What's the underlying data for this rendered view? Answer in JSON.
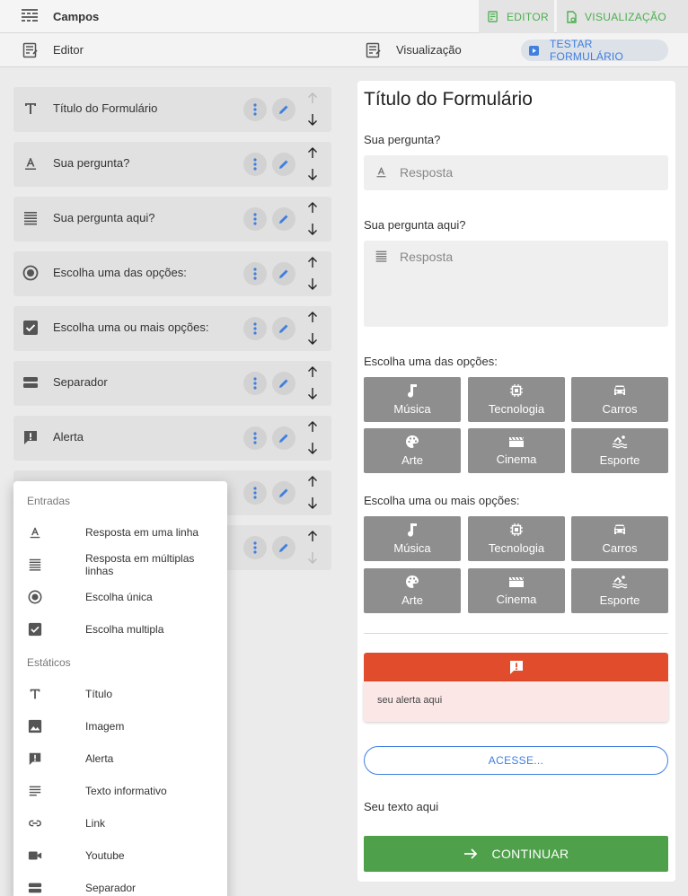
{
  "topbar": {
    "title": "Campos",
    "tab_editor": "EDITOR",
    "tab_view": "VISUALIZAÇÃO"
  },
  "subbar": {
    "editor_label": "Editor",
    "view_label": "Visualização",
    "test_label": "TESTAR FORMULÁRIO"
  },
  "fields": [
    {
      "label": "Título do Formulário",
      "icon": "title-icon"
    },
    {
      "label": "Sua pergunta?",
      "icon": "short-text-icon"
    },
    {
      "label": "Sua pergunta aqui?",
      "icon": "long-text-icon"
    },
    {
      "label": "Escolha uma das opções:",
      "icon": "radio-icon"
    },
    {
      "label": "Escolha uma ou mais opções:",
      "icon": "checkbox-icon"
    },
    {
      "label": "Separador",
      "icon": "separator-icon"
    },
    {
      "label": "Alerta",
      "icon": "alert-icon"
    }
  ],
  "menu": {
    "group_inputs": "Entradas",
    "group_static": "Estáticos",
    "items": [
      {
        "label": "Resposta em uma linha",
        "icon": "short-text-icon"
      },
      {
        "label": "Resposta em múltiplas linhas",
        "icon": "long-text-icon"
      },
      {
        "label": "Escolha única",
        "icon": "radio-icon"
      },
      {
        "label": "Escolha multipla",
        "icon": "checkbox-icon"
      },
      {
        "label": "Título",
        "icon": "title-icon"
      },
      {
        "label": "Imagem",
        "icon": "image-icon"
      },
      {
        "label": "Alerta",
        "icon": "alert-icon"
      },
      {
        "label": "Texto informativo",
        "icon": "text-info-icon"
      },
      {
        "label": "Link",
        "icon": "link-icon"
      },
      {
        "label": "Youtube",
        "icon": "video-icon"
      },
      {
        "label": "Separador",
        "icon": "separator-icon"
      }
    ]
  },
  "preview": {
    "title": "Título do Formulário",
    "q1": "Sua pergunta?",
    "q1_placeholder": "Resposta",
    "q2": "Sua pergunta aqui?",
    "q2_placeholder": "Resposta",
    "q3": "Escolha uma das opções:",
    "q4": "Escolha uma ou mais opções:",
    "options": [
      "Música",
      "Tecnologia",
      "Carros",
      "Arte",
      "Cinema",
      "Esporte"
    ],
    "alert_text": "seu alerta aqui",
    "link_label": "ACESSE...",
    "info_text": "Seu texto aqui",
    "continue_label": "CONTINUAR"
  },
  "colors": {
    "green": "#4caf50",
    "blue": "#3f7fe0",
    "alert_red": "#e04c2c",
    "option_gray": "#8e8e8e"
  }
}
